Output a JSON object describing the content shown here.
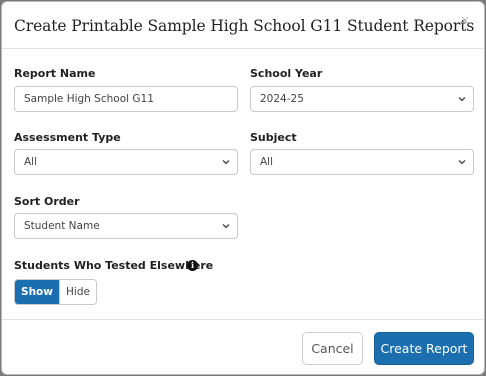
{
  "dialog": {
    "title": "Create Printable Sample High School G11 Student Reports",
    "close_glyph": "×"
  },
  "form": {
    "report_name": {
      "label": "Report Name",
      "value": "Sample High School G11"
    },
    "school_year": {
      "label": "School Year",
      "selected": "2024-25"
    },
    "assessment_type": {
      "label": "Assessment Type",
      "selected": "All"
    },
    "subject": {
      "label": "Subject",
      "selected": "All"
    },
    "sort_order": {
      "label": "Sort Order",
      "selected": "Student Name"
    },
    "tested_elsewhere": {
      "label": "Students Who Tested Elsewhere",
      "info_glyph": "i",
      "options": [
        "Show",
        "Hide"
      ],
      "selected": "Show"
    }
  },
  "footer": {
    "cancel_label": "Cancel",
    "create_label": "Create Report"
  },
  "colors": {
    "primary": "#1b6fae",
    "border": "#c9c9c9",
    "backdrop": "#7a7a7a"
  },
  "icons": [
    "close-icon",
    "chevron-down-icon",
    "info-icon"
  ]
}
